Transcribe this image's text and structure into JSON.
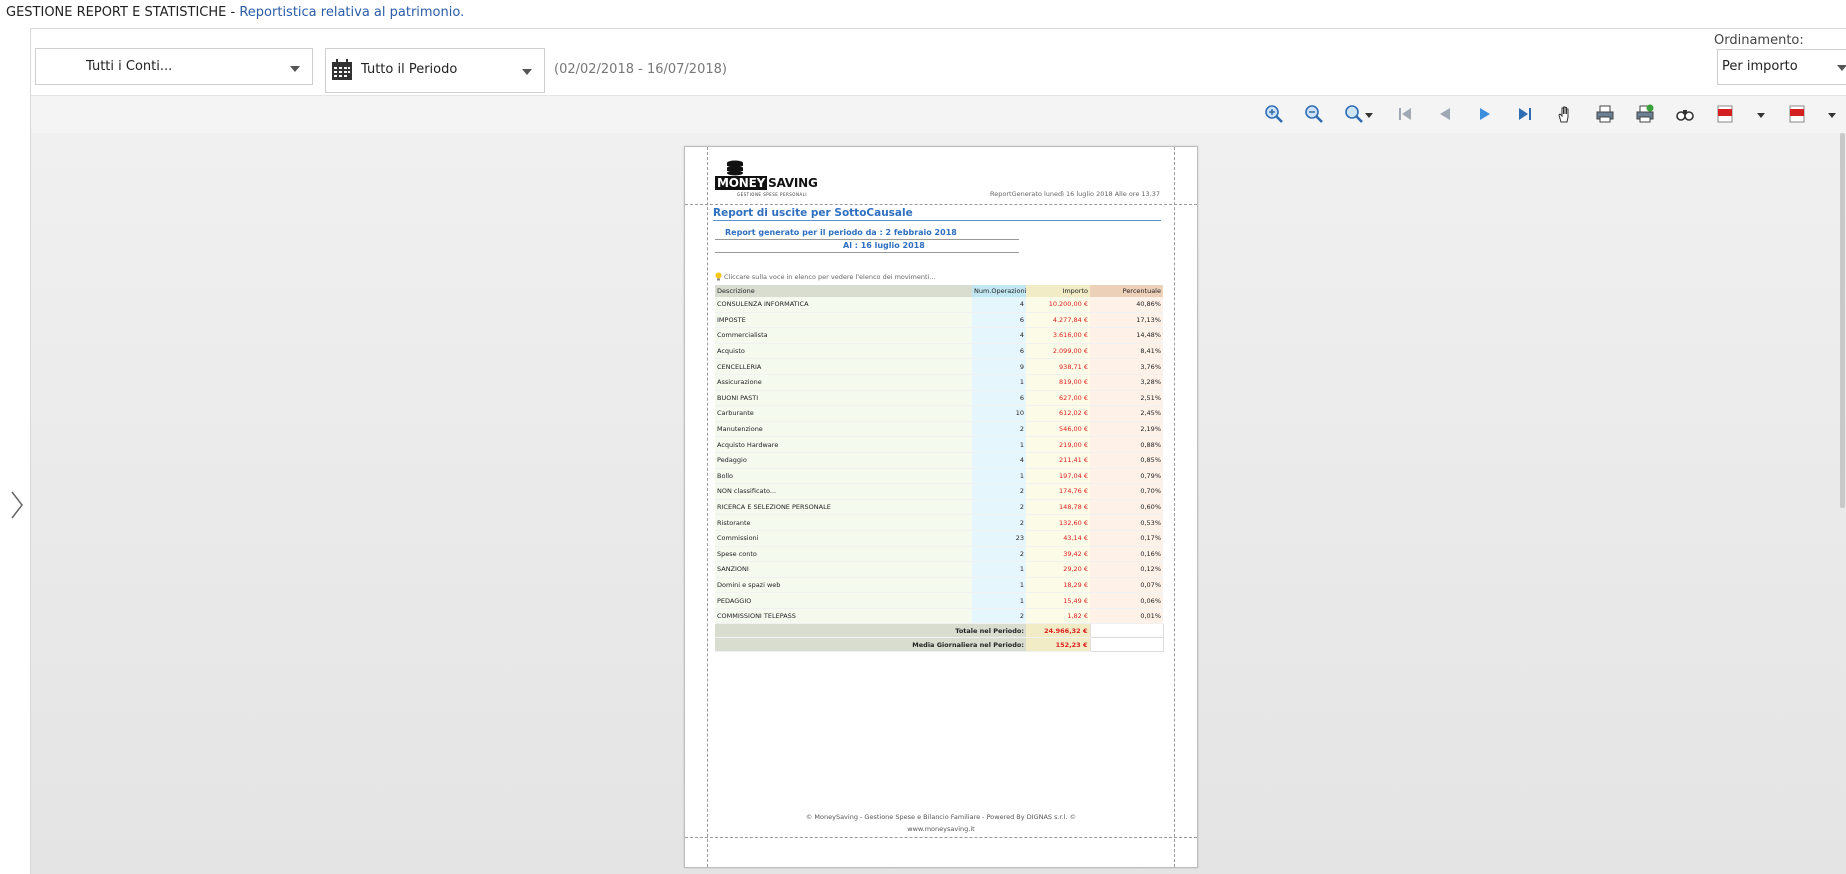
{
  "header": {
    "title": "GESTIONE REPORT E STATISTICHE - ",
    "subtitle": "Reportistica relativa al patrimonio."
  },
  "filters": {
    "accounts": "Tutti i Conti...",
    "period": "Tutto il Periodo",
    "date_range": "(02/02/2018 - 16/07/2018)",
    "ordering_label": "Ordinamento:",
    "ordering_value": "Per importo"
  },
  "toolbar_icons": [
    "zoom-in-icon",
    "zoom-out-icon",
    "zoom-menu-icon",
    "first-page-icon",
    "previous-page-icon",
    "next-page-icon",
    "last-page-icon",
    "hand-tool-icon",
    "print-icon",
    "print-page-icon",
    "find-icon",
    "export-pdf-icon",
    "export-menu-icon"
  ],
  "report": {
    "logo_word_1": "MONEY",
    "logo_word_2": "SAVING",
    "logo_tagline": "GESTIONE SPESE PERSONALI",
    "generated": "ReportGenerato lunedì 16 luglio 2018 Alle ore 13.37",
    "title": "Report di uscite per SottoCausale",
    "period_from": "Report generato per il periodo da : 2 febbraio 2018",
    "period_to": "Al : 16 luglio 2018",
    "hint": "Cliccare sulla voce in elenco per vedere l'elenco dei movimenti...",
    "columns": {
      "descr": "Descrizione",
      "ops": "Num.Operazioni",
      "amount": "Importo",
      "percent": "Percentuale"
    },
    "rows": [
      {
        "descr": "CONSULENZA INFORMATICA",
        "ops": "4",
        "amount": "10.200,00 €",
        "percent": "40,86%"
      },
      {
        "descr": "IMPOSTE",
        "ops": "6",
        "amount": "4.277,84 €",
        "percent": "17,13%"
      },
      {
        "descr": "Commercialista",
        "ops": "4",
        "amount": "3.616,00 €",
        "percent": "14,48%"
      },
      {
        "descr": "Acquisto",
        "ops": "6",
        "amount": "2.099,00 €",
        "percent": "8,41%"
      },
      {
        "descr": "CENCELLERIA",
        "ops": "9",
        "amount": "938,71 €",
        "percent": "3,76%"
      },
      {
        "descr": "Assicurazione",
        "ops": "1",
        "amount": "819,00 €",
        "percent": "3,28%"
      },
      {
        "descr": "BUONI PASTI",
        "ops": "6",
        "amount": "627,00 €",
        "percent": "2,51%"
      },
      {
        "descr": "Carburante",
        "ops": "10",
        "amount": "612,02 €",
        "percent": "2,45%"
      },
      {
        "descr": "Manutenzione",
        "ops": "2",
        "amount": "546,00 €",
        "percent": "2,19%"
      },
      {
        "descr": "Acquisto Hardware",
        "ops": "1",
        "amount": "219,00 €",
        "percent": "0,88%"
      },
      {
        "descr": "Pedaggio",
        "ops": "4",
        "amount": "211,41 €",
        "percent": "0,85%"
      },
      {
        "descr": "Bollo",
        "ops": "1",
        "amount": "197,04 €",
        "percent": "0,79%"
      },
      {
        "descr": "NON classificato...",
        "ops": "2",
        "amount": "174,76 €",
        "percent": "0,70%"
      },
      {
        "descr": "RICERCA E SELEZIONE PERSONALE",
        "ops": "2",
        "amount": "148,78 €",
        "percent": "0,60%"
      },
      {
        "descr": "Ristorante",
        "ops": "2",
        "amount": "132,60 €",
        "percent": "0,53%"
      },
      {
        "descr": "Commissioni",
        "ops": "23",
        "amount": "43,14 €",
        "percent": "0,17%"
      },
      {
        "descr": "Spese conto",
        "ops": "2",
        "amount": "39,42 €",
        "percent": "0,16%"
      },
      {
        "descr": "SANZIONI",
        "ops": "1",
        "amount": "29,20 €",
        "percent": "0,12%"
      },
      {
        "descr": "Domini e spazi web",
        "ops": "1",
        "amount": "18,29 €",
        "percent": "0,07%"
      },
      {
        "descr": "PEDAGGIO",
        "ops": "1",
        "amount": "15,49 €",
        "percent": "0,06%"
      },
      {
        "descr": "COMMISSIONI TELEPASS",
        "ops": "2",
        "amount": "1,82 €",
        "percent": "0,01%"
      }
    ],
    "total_label": "Totale nel Periodo:",
    "total_value": "24.966,32 €",
    "avg_label": "Media Giornaliera nel Periodo:",
    "avg_value": "152,23 €",
    "footer_line1": "© MoneySaving - Gestione Spese e Bilancio Familiare - Powered By DIGNAS s.r.l. ©",
    "footer_line2": "www.moneysaving.it"
  },
  "colors": {
    "accent_blue": "#2e6fbf",
    "amount_red": "#e02020",
    "header_text": "#2a5ca8"
  }
}
